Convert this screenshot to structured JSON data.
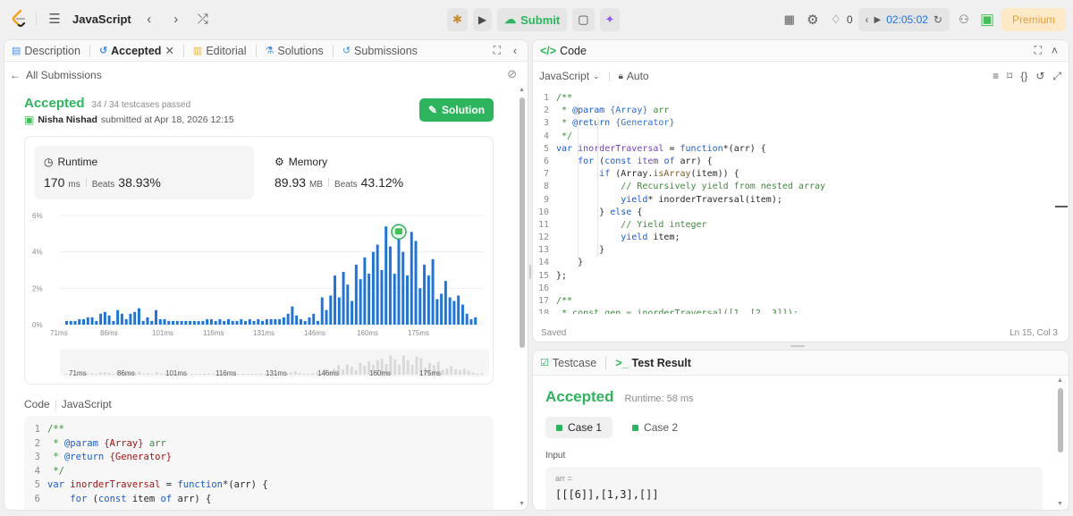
{
  "topbar": {
    "title": "JavaScript",
    "submit_label": "Submit",
    "timer": "02:05:02",
    "counter": "0",
    "premium_label": "Premium"
  },
  "left": {
    "tabs": [
      {
        "label": "Description"
      },
      {
        "label": "Accepted"
      },
      {
        "label": "Editorial"
      },
      {
        "label": "Solutions"
      },
      {
        "label": "Submissions"
      }
    ],
    "back_label": "All Submissions",
    "status": "Accepted",
    "testcases": "34 / 34 testcases passed",
    "user_name": "Nisha Nishad",
    "submitted_text": "submitted at Apr 18, 2026 12:15",
    "solution_button": "Solution",
    "runtime": {
      "label": "Runtime",
      "value": "170",
      "unit": "ms",
      "beats_label": "Beats",
      "beats": "38.93%"
    },
    "memory": {
      "label": "Memory",
      "value": "89.93",
      "unit": "MB",
      "beats_label": "Beats",
      "beats": "43.12%"
    },
    "code_header": "Code",
    "code_lang": "JavaScript"
  },
  "chart_data": {
    "type": "bar",
    "ytick_labels": [
      "6%",
      "4%",
      "2%",
      "0%"
    ],
    "xtick_labels": [
      "71ms",
      "86ms",
      "101ms",
      "116ms",
      "131ms",
      "146ms",
      "160ms",
      "175ms"
    ],
    "ylim": [
      0,
      6
    ],
    "values": [
      0.2,
      0.2,
      0.2,
      0.3,
      0.3,
      0.4,
      0.4,
      0.2,
      0.6,
      0.7,
      0.5,
      0.2,
      0.8,
      0.6,
      0.3,
      0.6,
      0.7,
      0.9,
      0.2,
      0.4,
      0.2,
      0.8,
      0.3,
      0.3,
      0.2,
      0.2,
      0.2,
      0.2,
      0.2,
      0.2,
      0.2,
      0.2,
      0.2,
      0.3,
      0.3,
      0.2,
      0.3,
      0.2,
      0.3,
      0.2,
      0.2,
      0.3,
      0.2,
      0.3,
      0.2,
      0.3,
      0.2,
      0.3,
      0.3,
      0.3,
      0.3,
      0.4,
      0.6,
      1.0,
      0.5,
      0.3,
      0.2,
      0.4,
      0.6,
      0.2,
      1.5,
      0.8,
      1.6,
      2.7,
      1.5,
      2.9,
      2.2,
      1.3,
      3.3,
      2.5,
      3.7,
      2.8,
      4.0,
      4.4,
      3.0,
      5.4,
      4.3,
      2.8,
      5.4,
      4.0,
      2.7,
      5.1,
      4.6,
      2.0,
      3.3,
      2.7,
      3.6,
      1.4,
      1.7,
      2.4,
      1.5,
      1.3,
      1.6,
      1.1,
      0.6,
      0.3,
      0.4
    ],
    "highlight_index": 78
  },
  "minimap_labels": [
    "71ms",
    "86ms",
    "101ms",
    "116ms",
    "131ms",
    "146ms",
    "160ms",
    "175ms"
  ],
  "left_code": [
    {
      "n": "1",
      "tokens": [
        [
          "cm",
          "/**"
        ]
      ]
    },
    {
      "n": "2",
      "tokens": [
        [
          "cm",
          " * "
        ],
        [
          "kw",
          "@param"
        ],
        [
          "cm",
          " "
        ],
        [
          "str",
          "{Array}"
        ],
        [
          "cm",
          " arr"
        ]
      ]
    },
    {
      "n": "3",
      "tokens": [
        [
          "cm",
          " * "
        ],
        [
          "kw",
          "@return"
        ],
        [
          "cm",
          " "
        ],
        [
          "str",
          "{Generator}"
        ]
      ]
    },
    {
      "n": "4",
      "tokens": [
        [
          "cm",
          " */"
        ]
      ]
    },
    {
      "n": "5",
      "tokens": [
        [
          "kw",
          "var"
        ],
        [
          "plain",
          " "
        ],
        [
          "str",
          "inorderTraversal"
        ],
        [
          "plain",
          " = "
        ],
        [
          "kw",
          "function"
        ],
        [
          "plain",
          "*(arr) {"
        ]
      ]
    },
    {
      "n": "6",
      "tokens": [
        [
          "plain",
          "    "
        ],
        [
          "kw",
          "for"
        ],
        [
          "plain",
          " ("
        ],
        [
          "kw",
          "const"
        ],
        [
          "plain",
          " item "
        ],
        [
          "kw",
          "of"
        ],
        [
          "plain",
          " arr) {"
        ]
      ]
    }
  ],
  "right": {
    "code_tab": "Code",
    "lang": "JavaScript",
    "auto": "Auto",
    "saved": "Saved",
    "cursor": "Ln 15, Col 3",
    "testcase_tab": "Testcase",
    "result_tab": "Test Result",
    "result_status": "Accepted",
    "result_runtime": "Runtime: 58 ms",
    "case1": "Case 1",
    "case2": "Case 2",
    "input_label": "Input",
    "input_var": "arr =",
    "input_value": "[[[6]],[1,3],[]]"
  },
  "right_code": [
    {
      "n": "1",
      "tokens": [
        [
          "cm",
          "/**"
        ]
      ]
    },
    {
      "n": "2",
      "tokens": [
        [
          "cm",
          " * "
        ],
        [
          "kw",
          "@param"
        ],
        [
          "cm",
          " "
        ],
        [
          "tag",
          "{Array}"
        ],
        [
          "cm",
          " arr"
        ]
      ]
    },
    {
      "n": "3",
      "tokens": [
        [
          "cm",
          " * "
        ],
        [
          "kw",
          "@return"
        ],
        [
          "cm",
          " "
        ],
        [
          "tag",
          "{Generator}"
        ]
      ]
    },
    {
      "n": "4",
      "tokens": [
        [
          "cm",
          " */"
        ]
      ]
    },
    {
      "n": "5",
      "tokens": [
        [
          "kw",
          "var"
        ],
        [
          "plain",
          " "
        ],
        [
          "var",
          "inorderTraversal"
        ],
        [
          "plain",
          " = "
        ],
        [
          "kw",
          "function"
        ],
        [
          "plain",
          "*(arr) {"
        ]
      ]
    },
    {
      "n": "6",
      "tokens": [
        [
          "plain",
          "    "
        ],
        [
          "kw",
          "for"
        ],
        [
          "plain",
          " ("
        ],
        [
          "kw",
          "const"
        ],
        [
          "plain",
          " "
        ],
        [
          "var",
          "item"
        ],
        [
          "plain",
          " "
        ],
        [
          "kw",
          "of"
        ],
        [
          "plain",
          " arr) {"
        ]
      ]
    },
    {
      "n": "7",
      "tokens": [
        [
          "plain",
          "        "
        ],
        [
          "kw",
          "if"
        ],
        [
          "plain",
          " (Array."
        ],
        [
          "fn",
          "isArray"
        ],
        [
          "plain",
          "(item)) {"
        ]
      ]
    },
    {
      "n": "8",
      "tokens": [
        [
          "plain",
          "            "
        ],
        [
          "cm",
          "// Recursively yield from nested array"
        ]
      ]
    },
    {
      "n": "9",
      "tokens": [
        [
          "plain",
          "            "
        ],
        [
          "kw",
          "yield"
        ],
        [
          "plain",
          "* inorderTraversal(item);"
        ]
      ]
    },
    {
      "n": "10",
      "tokens": [
        [
          "plain",
          "        } "
        ],
        [
          "kw",
          "else"
        ],
        [
          "plain",
          " {"
        ]
      ]
    },
    {
      "n": "11",
      "tokens": [
        [
          "plain",
          "            "
        ],
        [
          "cm",
          "// Yield integer"
        ]
      ]
    },
    {
      "n": "12",
      "tokens": [
        [
          "plain",
          "            "
        ],
        [
          "kw",
          "yield"
        ],
        [
          "plain",
          " item;"
        ]
      ]
    },
    {
      "n": "13",
      "tokens": [
        [
          "plain",
          "        }"
        ]
      ]
    },
    {
      "n": "14",
      "tokens": [
        [
          "plain",
          "    }"
        ]
      ]
    },
    {
      "n": "15",
      "tokens": [
        [
          "plain",
          "};"
        ]
      ]
    },
    {
      "n": "16",
      "tokens": [
        [
          "plain",
          ""
        ]
      ]
    },
    {
      "n": "17",
      "tokens": [
        [
          "cm",
          "/**"
        ]
      ]
    },
    {
      "n": "18",
      "tokens": [
        [
          "cm",
          " * const gen = inorderTraversal([1, [2, 3]]);"
        ]
      ]
    }
  ]
}
